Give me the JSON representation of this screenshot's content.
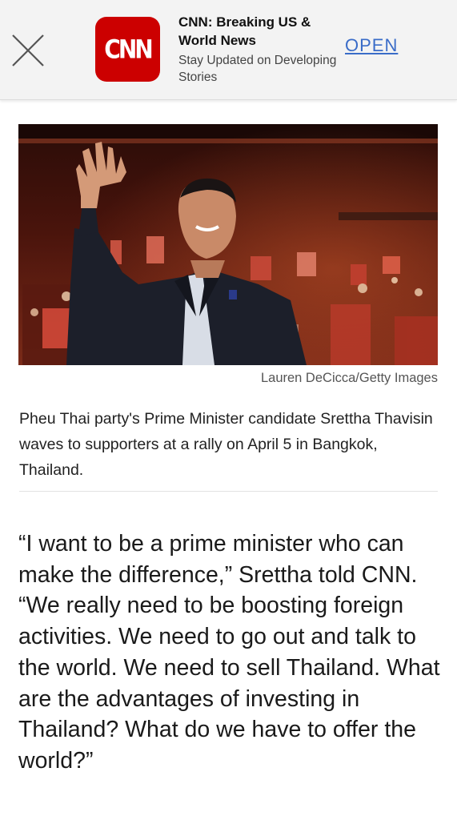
{
  "banner": {
    "close_icon": "close-icon",
    "app_logo_text": "CNN",
    "app_title": "CNN: Breaking US & World News",
    "app_subtitle": "Stay Updated on Developing Stories",
    "open_label": "OPEN"
  },
  "article": {
    "image_credit": "Lauren DeCicca/Getty Images",
    "caption": "Pheu Thai party's Prime Minister candidate Srettha Thavisin waves to supporters at a rally on April 5 in Bangkok, Thailand.",
    "quote": "“I want to be a prime minister who can make the difference,” Srettha told CNN. “We really need to be boosting foreign activities. We need to go out and talk to the world. We need to sell Thailand. What are the advantages of investing in Thailand? What do we have to offer the world?”"
  },
  "colors": {
    "brand_red": "#cc0000",
    "link_blue": "#3a6cc8"
  }
}
